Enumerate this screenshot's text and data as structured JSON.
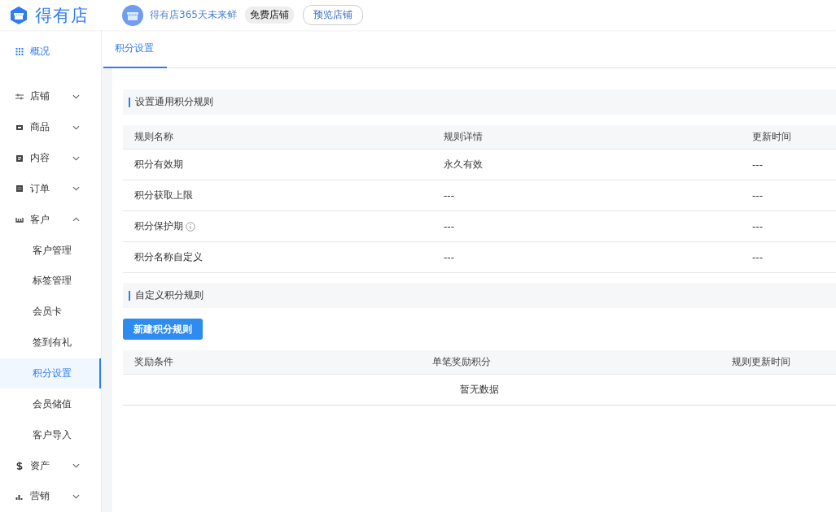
{
  "header": {
    "brand": "得有店",
    "shop_name": "得有店365天未来鲜",
    "shop_badge": "免费店铺",
    "preview_button": "预览店铺"
  },
  "sidebar": {
    "items": [
      {
        "kind": "link",
        "label": "概况"
      },
      {
        "kind": "group",
        "label": "店铺",
        "expanded": false
      },
      {
        "kind": "group",
        "label": "商品",
        "expanded": false
      },
      {
        "kind": "group",
        "label": "内容",
        "expanded": false
      },
      {
        "kind": "group",
        "label": "订单",
        "expanded": false
      },
      {
        "kind": "group",
        "label": "客户",
        "expanded": true,
        "children": [
          {
            "label": "客户管理",
            "selected": false
          },
          {
            "label": "标签管理",
            "selected": false
          },
          {
            "label": "会员卡",
            "selected": false
          },
          {
            "label": "签到有礼",
            "selected": false
          },
          {
            "label": "积分设置",
            "selected": true
          },
          {
            "label": "会员储值",
            "selected": false
          },
          {
            "label": "客户导入",
            "selected": false
          }
        ]
      },
      {
        "kind": "group",
        "label": "资产",
        "expanded": false
      },
      {
        "kind": "group",
        "label": "营销",
        "expanded": false
      }
    ]
  },
  "tabs": [
    {
      "label": "积分设置",
      "selected": true
    }
  ],
  "general_rules": {
    "title": "设置通用积分规则",
    "columns": [
      "规则名称",
      "规则详情",
      "更新时间"
    ],
    "rows": [
      {
        "name": "积分有效期",
        "detail": "永久有效",
        "updated": "---",
        "info": false
      },
      {
        "name": "积分获取上限",
        "detail": "---",
        "updated": "---",
        "info": false
      },
      {
        "name": "积分保护期",
        "detail": "---",
        "updated": "---",
        "info": true
      },
      {
        "name": "积分名称自定义",
        "detail": "---",
        "updated": "---",
        "info": false
      }
    ]
  },
  "custom_rules": {
    "title": "自定义积分规则",
    "new_button": "新建积分规则",
    "columns": [
      "奖励条件",
      "单笔奖励积分",
      "规则更新时间"
    ],
    "empty_text": "暂无数据"
  }
}
